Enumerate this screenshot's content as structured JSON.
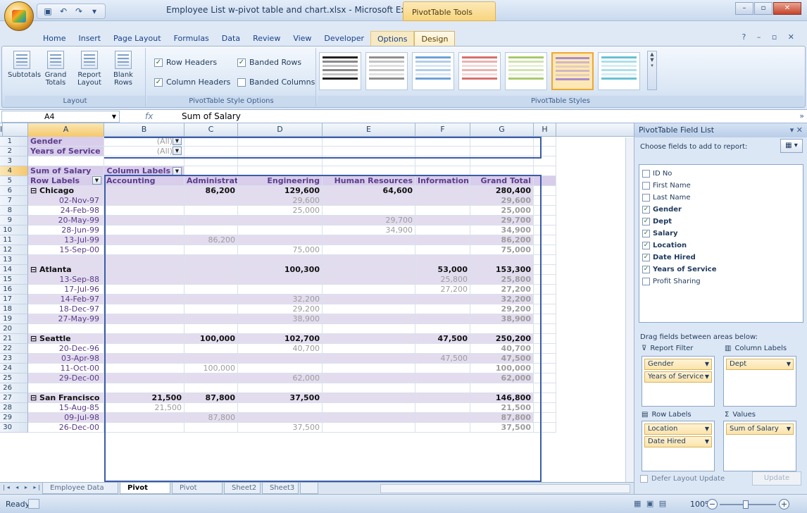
{
  "window": {
    "title": "Employee List w-pivot table and chart.xlsx - Microsoft Excel",
    "context_tools": "PivotTable Tools",
    "minimize": "–",
    "restore": "▫",
    "close": "✕"
  },
  "quick_access": [
    "save-icon",
    "undo-icon",
    "redo-icon",
    "customize-icon"
  ],
  "tabs": [
    "Home",
    "Insert",
    "Page Layout",
    "Formulas",
    "Data",
    "Review",
    "View",
    "Developer",
    "Options",
    "Design"
  ],
  "active_tab": "Design",
  "help_icons": "? – ▫ ✕",
  "ribbon": {
    "layout": {
      "title": "Layout",
      "buttons": [
        "Subtotals",
        "Grand Totals",
        "Report Layout",
        "Blank Rows"
      ],
      "sub": [
        "▾",
        "Totals ▾",
        "Layout ▾ Rows ▾",
        ""
      ]
    },
    "options": {
      "title": "PivotTable Style Options",
      "row_headers": "Row Headers",
      "banded_rows": "Banded Rows",
      "column_headers": "Column Headers",
      "banded_columns": "Banded Columns",
      "checked": {
        "row_headers": true,
        "banded_rows": true,
        "column_headers": true,
        "banded_columns": false
      }
    },
    "styles": {
      "title": "PivotTable Styles",
      "swatch_colors": [
        "#222222",
        "#8e8e8e",
        "#6fa1d6",
        "#d76f6f",
        "#a8c96c",
        "#a88ccc",
        "#67c1d3"
      ],
      "selected_index": 5
    }
  },
  "formula_bar": {
    "cell": "A4",
    "fx": "fx",
    "value": "Sum of Salary"
  },
  "columns": [
    "A",
    "B",
    "C",
    "D",
    "E",
    "F",
    "G",
    "H",
    "I"
  ],
  "grid_rows": [
    {
      "n": "1",
      "cells": [
        "Gender",
        "(All)",
        "",
        "",
        "",
        "",
        "",
        ""
      ],
      "type": "filter"
    },
    {
      "n": "2",
      "cells": [
        "Years of Service",
        "(All)",
        "",
        "",
        "",
        "",
        "",
        ""
      ],
      "type": "filter"
    },
    {
      "n": "3",
      "cells": [
        "",
        "",
        "",
        "",
        "",
        "",
        "",
        ""
      ],
      "type": "blank"
    },
    {
      "n": "4",
      "cells": [
        "Sum of Salary",
        "Column Labels",
        "",
        "",
        "",
        "",
        "",
        ""
      ],
      "type": "hdr1"
    },
    {
      "n": "5",
      "cells": [
        "Row Labels",
        "Accounting",
        "Administration",
        "Engineering",
        "Human Resources",
        "Information Services",
        "Grand Total",
        ""
      ],
      "type": "hdr2"
    },
    {
      "n": "6",
      "cells": [
        "Chicago",
        "",
        "86,200",
        "129,600",
        "64,600",
        "",
        "280,400",
        ""
      ],
      "type": "group"
    },
    {
      "n": "7",
      "cells": [
        "02-Nov-97",
        "",
        "",
        "29,600",
        "",
        "",
        "29,600",
        ""
      ],
      "type": "item"
    },
    {
      "n": "8",
      "cells": [
        "24-Feb-98",
        "",
        "",
        "25,000",
        "",
        "",
        "25,000",
        ""
      ],
      "type": "item"
    },
    {
      "n": "9",
      "cells": [
        "20-May-99",
        "",
        "",
        "",
        "29,700",
        "",
        "29,700",
        ""
      ],
      "type": "item"
    },
    {
      "n": "10",
      "cells": [
        "28-Jun-99",
        "",
        "",
        "",
        "34,900",
        "",
        "34,900",
        ""
      ],
      "type": "item"
    },
    {
      "n": "11",
      "cells": [
        "13-Jul-99",
        "",
        "86,200",
        "",
        "",
        "",
        "86,200",
        ""
      ],
      "type": "item"
    },
    {
      "n": "12",
      "cells": [
        "15-Sep-00",
        "",
        "",
        "75,000",
        "",
        "",
        "75,000",
        ""
      ],
      "type": "item"
    },
    {
      "n": "13",
      "cells": [
        "",
        "",
        "",
        "",
        "",
        "",
        "",
        ""
      ],
      "type": "gap"
    },
    {
      "n": "14",
      "cells": [
        "Atlanta",
        "",
        "",
        "100,300",
        "",
        "53,000",
        "153,300",
        ""
      ],
      "type": "group"
    },
    {
      "n": "15",
      "cells": [
        "13-Sep-88",
        "",
        "",
        "",
        "",
        "25,800",
        "25,800",
        ""
      ],
      "type": "item"
    },
    {
      "n": "16",
      "cells": [
        "17-Jul-96",
        "",
        "",
        "",
        "",
        "27,200",
        "27,200",
        ""
      ],
      "type": "item"
    },
    {
      "n": "17",
      "cells": [
        "14-Feb-97",
        "",
        "",
        "32,200",
        "",
        "",
        "32,200",
        ""
      ],
      "type": "item"
    },
    {
      "n": "18",
      "cells": [
        "18-Dec-97",
        "",
        "",
        "29,200",
        "",
        "",
        "29,200",
        ""
      ],
      "type": "item"
    },
    {
      "n": "19",
      "cells": [
        "27-May-99",
        "",
        "",
        "38,900",
        "",
        "",
        "38,900",
        ""
      ],
      "type": "item"
    },
    {
      "n": "20",
      "cells": [
        "",
        "",
        "",
        "",
        "",
        "",
        "",
        ""
      ],
      "type": "gap"
    },
    {
      "n": "21",
      "cells": [
        "Seattle",
        "",
        "100,000",
        "102,700",
        "",
        "47,500",
        "250,200",
        ""
      ],
      "type": "group"
    },
    {
      "n": "22",
      "cells": [
        "20-Dec-96",
        "",
        "",
        "40,700",
        "",
        "",
        "40,700",
        ""
      ],
      "type": "item"
    },
    {
      "n": "23",
      "cells": [
        "03-Apr-98",
        "",
        "",
        "",
        "",
        "47,500",
        "47,500",
        ""
      ],
      "type": "item"
    },
    {
      "n": "24",
      "cells": [
        "11-Oct-00",
        "",
        "100,000",
        "",
        "",
        "",
        "100,000",
        ""
      ],
      "type": "item"
    },
    {
      "n": "25",
      "cells": [
        "29-Dec-00",
        "",
        "",
        "62,000",
        "",
        "",
        "62,000",
        ""
      ],
      "type": "item"
    },
    {
      "n": "26",
      "cells": [
        "",
        "",
        "",
        "",
        "",
        "",
        "",
        ""
      ],
      "type": "gap"
    },
    {
      "n": "27",
      "cells": [
        "San Francisco",
        "21,500",
        "87,800",
        "37,500",
        "",
        "",
        "146,800",
        ""
      ],
      "type": "group"
    },
    {
      "n": "28",
      "cells": [
        "15-Aug-85",
        "21,500",
        "",
        "",
        "",
        "",
        "21,500",
        ""
      ],
      "type": "item"
    },
    {
      "n": "29",
      "cells": [
        "09-Jul-98",
        "",
        "87,800",
        "",
        "",
        "",
        "87,800",
        ""
      ],
      "type": "item"
    },
    {
      "n": "30",
      "cells": [
        "26-Dec-00",
        "",
        "",
        "37,500",
        "",
        "",
        "37,500",
        ""
      ],
      "type": "item"
    }
  ],
  "sheet_tabs": [
    "Employee Data List",
    "Pivot Table",
    "Pivot Chart",
    "Sheet2",
    "Sheet3"
  ],
  "active_sheet": "Pivot Table",
  "status": {
    "ready": "Ready",
    "zoom": "100%",
    "zoom_level_percent": 100
  },
  "field_pane": {
    "title": "PivotTable Field List",
    "choose_label": "Choose fields to add to report:",
    "fields": [
      {
        "label": "ID No",
        "checked": false
      },
      {
        "label": "First Name",
        "checked": false
      },
      {
        "label": "Last Name",
        "checked": false
      },
      {
        "label": "Gender",
        "checked": true
      },
      {
        "label": "Dept",
        "checked": true
      },
      {
        "label": "Salary",
        "checked": true
      },
      {
        "label": "Location",
        "checked": true
      },
      {
        "label": "Date Hired",
        "checked": true
      },
      {
        "label": "Years of Service",
        "checked": true
      },
      {
        "label": "Profit Sharing",
        "checked": false
      }
    ],
    "drag_label": "Drag fields between areas below:",
    "areas": {
      "report_filter": {
        "title": "Report Filter",
        "items": [
          "Gender",
          "Years of Service"
        ]
      },
      "column_labels": {
        "title": "Column Labels",
        "items": [
          "Dept"
        ]
      },
      "row_labels": {
        "title": "Row Labels",
        "items": [
          "Location",
          "Date Hired"
        ]
      },
      "values": {
        "title": "Values",
        "items": [
          "Sum of Salary"
        ]
      }
    },
    "defer_label": "Defer Layout Update",
    "update_label": "Update"
  }
}
